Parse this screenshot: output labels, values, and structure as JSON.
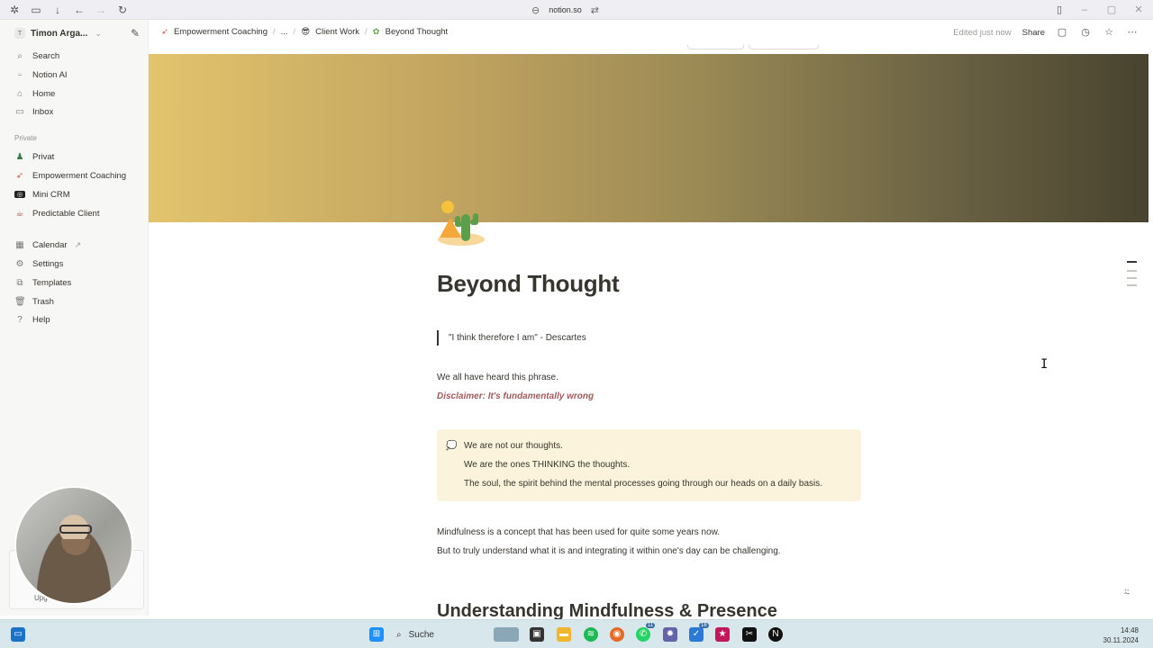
{
  "browser": {
    "url": "notion.so"
  },
  "sidebar": {
    "workspace": "Timon Arga...",
    "workspace_badge": "T",
    "top_items": [
      {
        "label": "Search",
        "icon": "search-icon"
      },
      {
        "label": "Notion AI",
        "icon": "ai-icon"
      },
      {
        "label": "Home",
        "icon": "home-icon"
      },
      {
        "label": "Inbox",
        "icon": "inbox-icon"
      }
    ],
    "private_label": "Private",
    "private_items": [
      {
        "label": "Privat",
        "icon": "person-icon"
      },
      {
        "label": "Empowerment Coaching",
        "icon": "rocket-icon"
      },
      {
        "label": "Mini CRM",
        "icon": "crm-icon"
      },
      {
        "label": "Predictable Client",
        "icon": "coffee-icon"
      }
    ],
    "bottom_items": [
      {
        "label": "Calendar",
        "icon": "calendar-icon"
      },
      {
        "label": "Settings",
        "icon": "gear-icon"
      },
      {
        "label": "Templates",
        "icon": "templates-icon"
      },
      {
        "label": "Trash",
        "icon": "trash-icon"
      },
      {
        "label": "Help",
        "icon": "help-icon"
      }
    ],
    "upgrade_partial": "Upg"
  },
  "topbar": {
    "breadcrumbs": [
      "Empowerment Coaching",
      "...",
      "Client Work",
      "Beyond Thought"
    ],
    "edited": "Edited just now",
    "share": "Share"
  },
  "page": {
    "title": "Beyond Thought",
    "quote": "\"I think therefore I am\" - Descartes",
    "para1": "We all have heard this phrase.",
    "disclaimer": "Disclaimer: It's fundamentally wrong",
    "callout": [
      "We are not our thoughts.",
      "We are the ones THINKING the thoughts.",
      "The soul, the spirit behind the mental processes going through our heads on a daily basis."
    ],
    "para2": "Mindfulness is a concept that has been used for quite some years now.",
    "para3": "But to truly understand what it is and integrating it within one's day can be challenging.",
    "heading2": "Understanding Mindfulness & Presence"
  },
  "taskbar": {
    "search": "Suche",
    "time": "14:48",
    "date": "30.11.2024",
    "badge_whatsapp": "11",
    "badge_todo": "16"
  },
  "colors": {
    "cover_start": "#e2c46d",
    "cover_end": "#48432f",
    "callout_bg": "#fbf3db",
    "disclaimer": "#9f5a5a"
  }
}
